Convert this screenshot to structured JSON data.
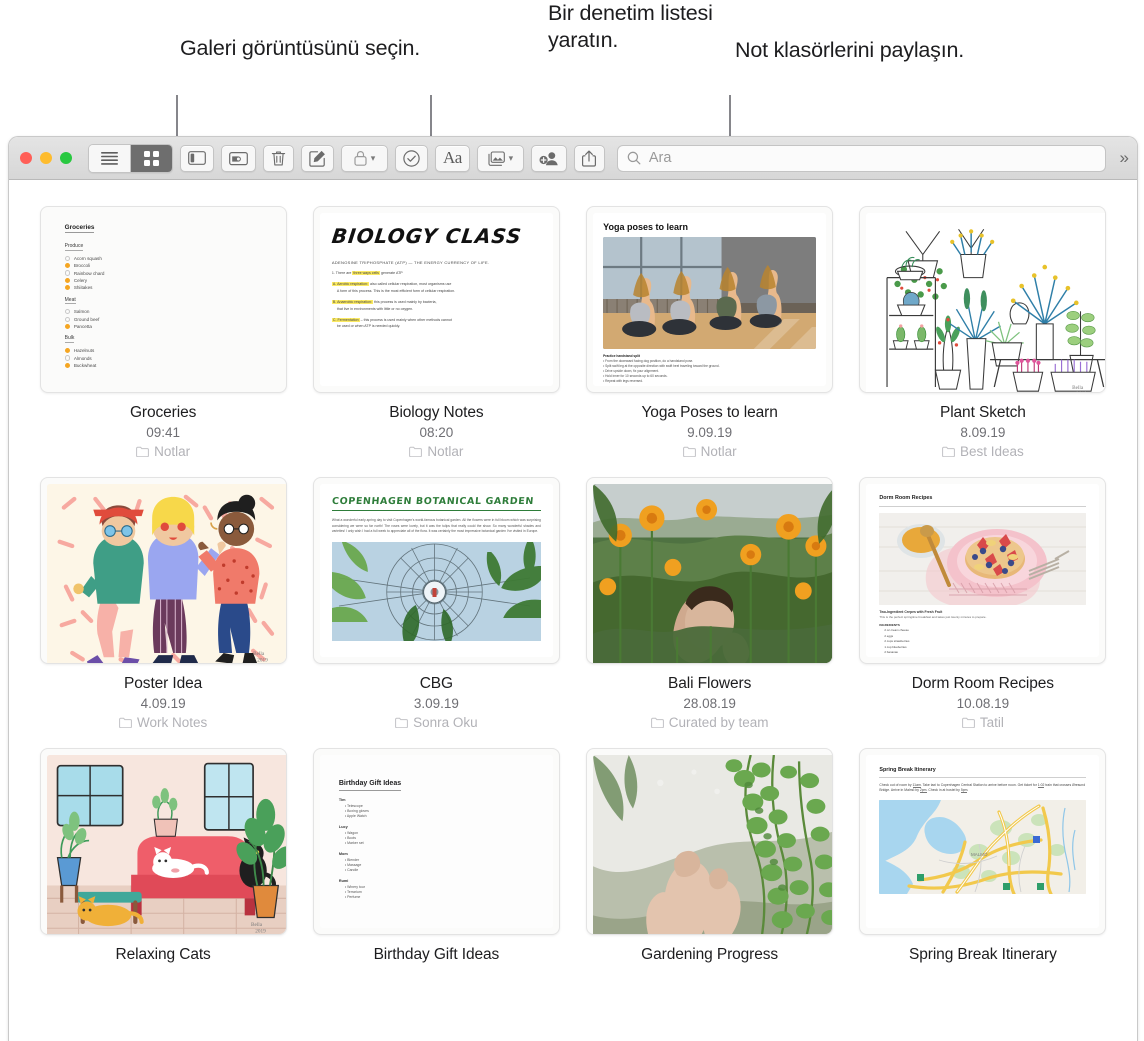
{
  "callouts": [
    {
      "id": "gallery-view",
      "text": "Galeri görüntüsünü seçin."
    },
    {
      "id": "checklist",
      "text": "Bir denetim listesi yaratın."
    },
    {
      "id": "share-folder",
      "text": "Not klasörlerini paylaşın."
    }
  ],
  "window": {
    "toolbar": {
      "view_list_label": "list-view",
      "view_gallery_label": "gallery-view",
      "buttons": [
        {
          "name": "sidebar-toggle-button",
          "icon": "sidebar-icon"
        },
        {
          "name": "folder-view-button",
          "icon": "folders-icon"
        },
        {
          "name": "delete-button",
          "icon": "trash-icon"
        },
        {
          "name": "compose-button",
          "icon": "compose-icon"
        },
        {
          "name": "lock-button",
          "icon": "lock-icon",
          "has_caret": true
        },
        {
          "name": "checklist-button",
          "icon": "checkmark-circle-icon"
        },
        {
          "name": "format-button",
          "icon": "aa-icon",
          "label": "Aa"
        },
        {
          "name": "media-button",
          "icon": "photo-icon",
          "has_caret": true
        },
        {
          "name": "add-people-button",
          "icon": "add-person-icon"
        },
        {
          "name": "share-button",
          "icon": "share-icon"
        }
      ],
      "search_placeholder": "Ara",
      "search_value": "",
      "overflow_label": "»"
    },
    "notes": [
      {
        "title": "Groceries",
        "date": "09:41",
        "folder": "Notlar",
        "art": "groceries"
      },
      {
        "title": "Biology Notes",
        "date": "08:20",
        "folder": "Notlar",
        "art": "biology"
      },
      {
        "title": "Yoga Poses to learn",
        "date": "9.09.19",
        "folder": "Notlar",
        "art": "yoga"
      },
      {
        "title": "Plant Sketch",
        "date": "8.09.19",
        "folder": "Best Ideas",
        "art": "plants"
      },
      {
        "title": "Poster Idea",
        "date": "4.09.19",
        "folder": "Work Notes",
        "art": "poster"
      },
      {
        "title": "CBG",
        "date": "3.09.19",
        "folder": "Sonra Oku",
        "art": "cbg"
      },
      {
        "title": "Bali Flowers",
        "date": "28.08.19",
        "folder": "Curated by team",
        "art": "bali"
      },
      {
        "title": "Dorm Room Recipes",
        "date": "10.08.19",
        "folder": "Tatil",
        "art": "dorm"
      },
      {
        "title": "Relaxing Cats",
        "date": "",
        "folder": "",
        "art": "cats"
      },
      {
        "title": "Birthday Gift Ideas",
        "date": "",
        "folder": "",
        "art": "birthday"
      },
      {
        "title": "Gardening Progress",
        "date": "",
        "folder": "",
        "art": "garden"
      },
      {
        "title": "Spring Break Itinerary",
        "date": "",
        "folder": "",
        "art": "spring"
      }
    ]
  },
  "thumbnails": {
    "groceries": {
      "heading": "Groceries",
      "sections": [
        {
          "name": "Produce",
          "items": [
            {
              "label": "Acorn squash",
              "checked": false
            },
            {
              "label": "Broccoli",
              "checked": true
            },
            {
              "label": "Rainbow chard",
              "checked": false
            },
            {
              "label": "Celery",
              "checked": true
            },
            {
              "label": "Shiitakes",
              "checked": true
            }
          ]
        },
        {
          "name": "Meat",
          "items": [
            {
              "label": "Salmon",
              "checked": false
            },
            {
              "label": "Ground beef",
              "checked": false
            },
            {
              "label": "Pancetta",
              "checked": true
            }
          ]
        },
        {
          "name": "Bulk",
          "items": [
            {
              "label": "Hazelnuts",
              "checked": true
            },
            {
              "label": "Almonds",
              "checked": false
            },
            {
              "label": "Buckwheat",
              "checked": true
            }
          ]
        }
      ],
      "check_color": "#f5a623"
    },
    "biology": {
      "title": "BIOLOGY CLASS",
      "subtitle": "ADENOSINE TRIPHOSPHATE (ATP) — THE ENERGY CURRENCY OF LIFE.",
      "lines": [
        "1. There are three ways cells generate ATP",
        "A. Aerobic respiration: also called cellular respiration, most organisms use",
        "A form of this process. This is the most efficient form of cellular respiration.",
        "B. Anaerobic respiration: this process is used mainly by bacteria,",
        "that live in environments with little or no oxygen.",
        "C. Fermentation: this process is used mainly when other methods cannot",
        "be used or when ATP is needed quickly."
      ],
      "highlight_color": "#fbea62"
    },
    "yoga": {
      "title": "Yoga poses to learn",
      "caption_heading": "Practice handstand split",
      "caption_lines": [
        "• From the downward facing dog position, do a handstand pose.",
        "• Split swift leg at the opposite direction with swift heel traveling toward the ground.",
        "• Drive upside down, fix your alignment.",
        "• Hold inner for 10 seconds up to 60 seconds.",
        "• Repeat with legs reversed."
      ]
    },
    "cbg": {
      "title": "COPENHAGEN BOTANICAL GARDEN",
      "body": "What a wonderful early-spring day to visit Copenhagen's world-famous botanical garden. All the flowers were in full bloom which was surprising considering we were so far north! The roses were lovely, but it was the tulips that really could the show. So many wonderful shades and varieties! I only wish I had a full week to appreciate all of the flora. It was certainly the most impressive botanical garden I've visited in Europe."
    },
    "dorm": {
      "title": "Dorm Room Recipes",
      "caption": "Two-Ingredient Crepes with Fresh Fruit",
      "subcaption": "This is the perfect springtime breakfast and takes just twenty minutes to prepare.",
      "ingredients_heading": "INGREDIENTS",
      "ingredients": [
        "2 oz cream cheese",
        "2 eggs",
        "2 cups strawberries",
        "1 cup blueberries",
        "2 bananas"
      ]
    },
    "birthday": {
      "title": "Birthday Gift Ideas",
      "groups": [
        {
          "name": "Tim",
          "items": [
            "Telescope",
            "Boxing gloves",
            "Apple Watch"
          ]
        },
        {
          "name": "Lucy",
          "items": [
            "Wagon",
            "Boots",
            "Marker set"
          ]
        },
        {
          "name": "Mom",
          "items": [
            "Blender",
            "Massage",
            "Candle"
          ]
        },
        {
          "name": "Rumi",
          "items": [
            "Winery tour",
            "Terrarium",
            "Perfume"
          ]
        }
      ]
    },
    "spring": {
      "title": "Spring Break Itinerary",
      "body_1": "Check out of room by ",
      "body_u1": "11am",
      "body_2": ". Take taxi to Copenhagen Central Station to arrive before noon. Get ticket for ",
      "body_u2": "1:02",
      "body_3": " train that crosses Øresund Bridge. Arrive in Malmö by ",
      "body_u3": "2pm",
      "body_4": ". Check in at hostel by ",
      "body_u4": "5pm",
      "body_5": ".",
      "map_label": "MALMÖ"
    }
  }
}
